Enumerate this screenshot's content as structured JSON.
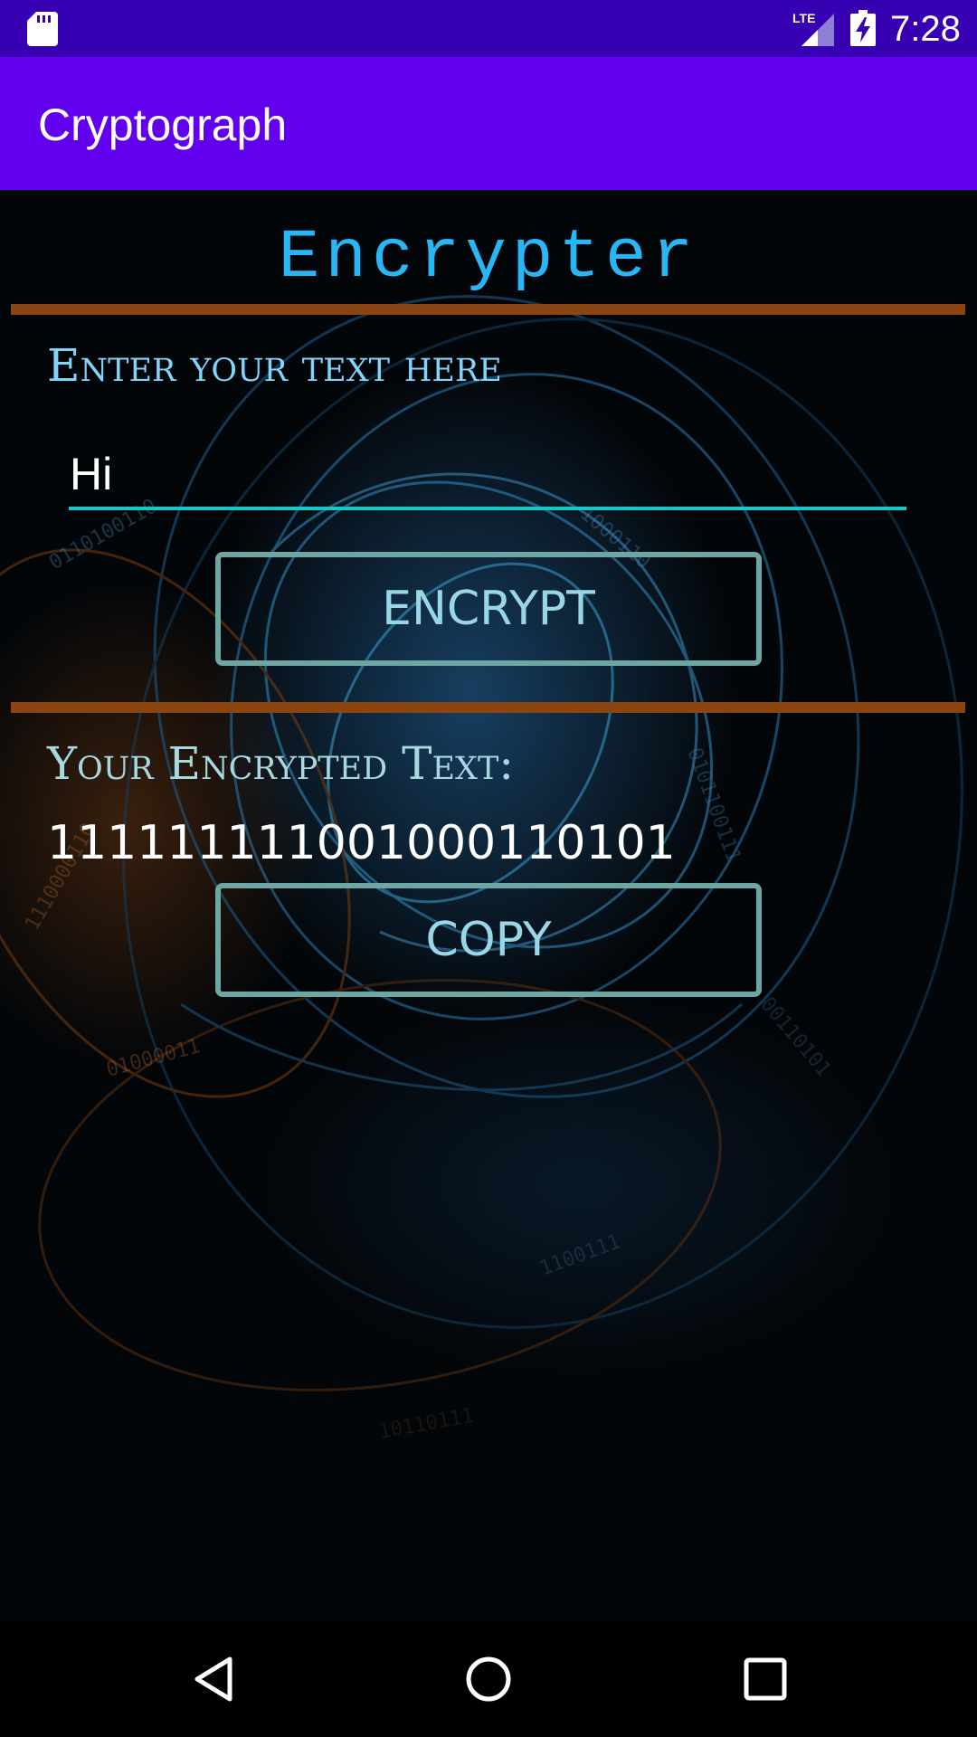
{
  "status_bar": {
    "time": "7:28",
    "signal_label": "LTE",
    "icons": [
      "sd-card-icon",
      "lte-signal-icon",
      "battery-charging-icon"
    ]
  },
  "app_bar": {
    "title": "Cryptograph",
    "color": "#6200ee"
  },
  "main": {
    "heading": "Encrypter",
    "input_label": "Enter your text here",
    "input_value": "Hi",
    "encrypt_button": "ENCRYPT",
    "output_label": "Your Encrypted Text:",
    "output_value": "111111111001000110101",
    "copy_button": "COPY"
  },
  "colors": {
    "status_bar": "#3700b3",
    "divider": "#8b4513",
    "accent": "#18c6c4",
    "heading": "#29b6f6"
  },
  "nav_bar": {
    "icons": [
      "back-icon",
      "home-icon",
      "recents-icon"
    ]
  }
}
